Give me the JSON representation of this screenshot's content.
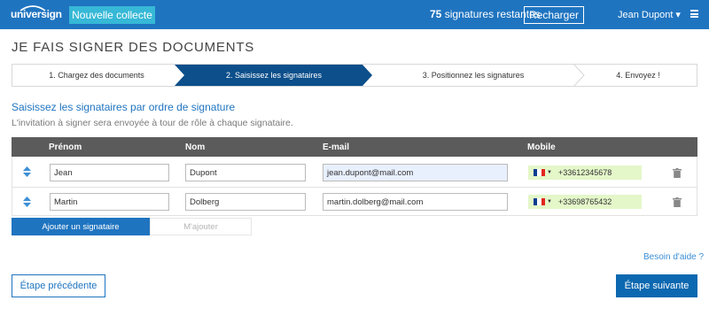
{
  "topbar": {
    "logo_text": "universign",
    "new_collect_label": "Nouvelle collecte",
    "signatures_count": "75",
    "signatures_text": "signatures restantes",
    "recharge_label": "Recharger",
    "user_name": "Jean Dupont ▾",
    "menu_icon": "hamburger-icon"
  },
  "page_title": "JE FAIS SIGNER DES DOCUMENTS",
  "steps": [
    {
      "label": "1. Chargez des documents",
      "active": false
    },
    {
      "label": "2. Saisissez les signataires",
      "active": true
    },
    {
      "label": "3. Positionnez les signatures",
      "active": false
    },
    {
      "label": "4. Envoyez !",
      "active": false
    }
  ],
  "instructions": {
    "title": "Saisissez les signataires par ordre de signature",
    "subtitle": "L'invitation à signer sera envoyée à tour de rôle à chaque signataire."
  },
  "table": {
    "headers": [
      "Prénom",
      "Nom",
      "E-mail",
      "Mobile"
    ],
    "rows": [
      {
        "first_name": "Jean",
        "last_name": "Dupont",
        "email": "jean.dupont@mail.com",
        "mobile": "+33612345678",
        "country": "FR"
      },
      {
        "first_name": "Martin",
        "last_name": "Dolberg",
        "email": "martin.dolberg@mail.com",
        "mobile": "+33698765432",
        "country": "FR"
      }
    ]
  },
  "actions": {
    "add_signer_label": "Ajouter un signataire",
    "add_self_label": "M'ajouter",
    "help_label": "Besoin d'aide ?",
    "prev_label": "Étape précédente",
    "next_label": "Étape suivante"
  },
  "colors": {
    "brand": "#1f74c0",
    "active_step": "#0c4f8b",
    "accent": "#36b8d6",
    "mobile_bg": "#e4f7c9"
  }
}
